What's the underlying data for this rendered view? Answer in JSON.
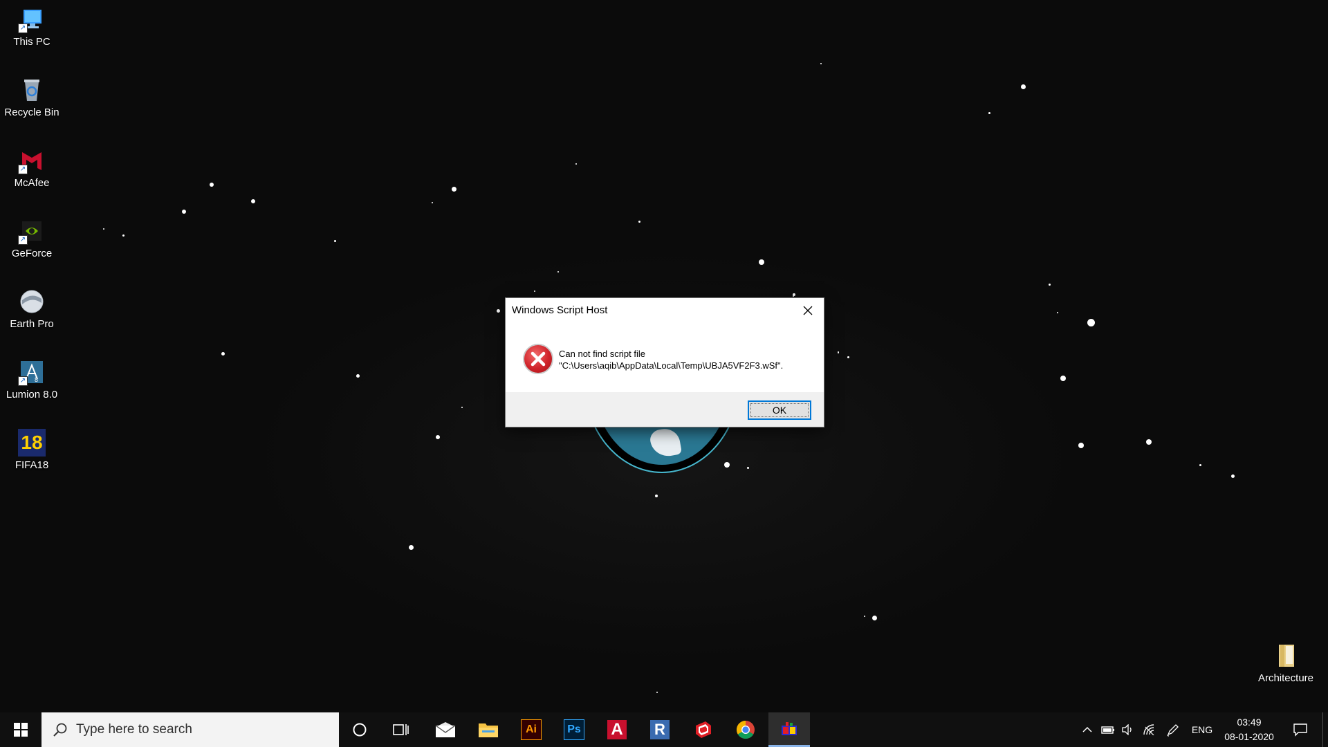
{
  "desktop": {
    "icons": [
      {
        "label": "This PC",
        "icon": "this-pc-icon"
      },
      {
        "label": "Recycle Bin",
        "icon": "recycle-bin-icon"
      },
      {
        "label": "McAfee",
        "icon": "mcafee-icon"
      },
      {
        "label": "GeForce",
        "icon": "geforce-icon"
      },
      {
        "label": "Earth Pro",
        "icon": "earth-pro-icon"
      },
      {
        "label": "Lumion 8.0",
        "icon": "lumion-icon"
      },
      {
        "label": "FIFA18",
        "icon": "fifa18-icon"
      }
    ],
    "right_icon": {
      "label": "Architecture",
      "icon": "folder-icon"
    },
    "fifa_badge": "18"
  },
  "dialog": {
    "title": "Windows Script Host",
    "message": "Can not find script file\n\"C:\\Users\\aqib\\AppData\\Local\\Temp\\UBJA5VF2F3.wSf\".",
    "ok_label": "OK"
  },
  "taskbar": {
    "search_placeholder": "Type here to search",
    "apps": [
      {
        "name": "mail-icon",
        "text": ""
      },
      {
        "name": "file-explorer-icon",
        "text": ""
      },
      {
        "name": "illustrator-icon",
        "text": "Ai",
        "color": "#ff9a00",
        "bg": "#330000"
      },
      {
        "name": "photoshop-icon",
        "text": "Ps",
        "color": "#31a8ff",
        "bg": "#001e36"
      },
      {
        "name": "autocad-icon",
        "text": "A",
        "color": "#ffffff",
        "bg": "#c8102e"
      },
      {
        "name": "revit-icon",
        "text": "R",
        "color": "#ffffff",
        "bg": "#3a6bb0"
      },
      {
        "name": "sketchup-icon",
        "text": "",
        "color": "#e01f26"
      },
      {
        "name": "chrome-icon",
        "text": ""
      },
      {
        "name": "active-app-icon",
        "text": ""
      }
    ],
    "tray": {
      "language": "ENG",
      "time": "03:49",
      "date": "08-01-2020"
    }
  }
}
